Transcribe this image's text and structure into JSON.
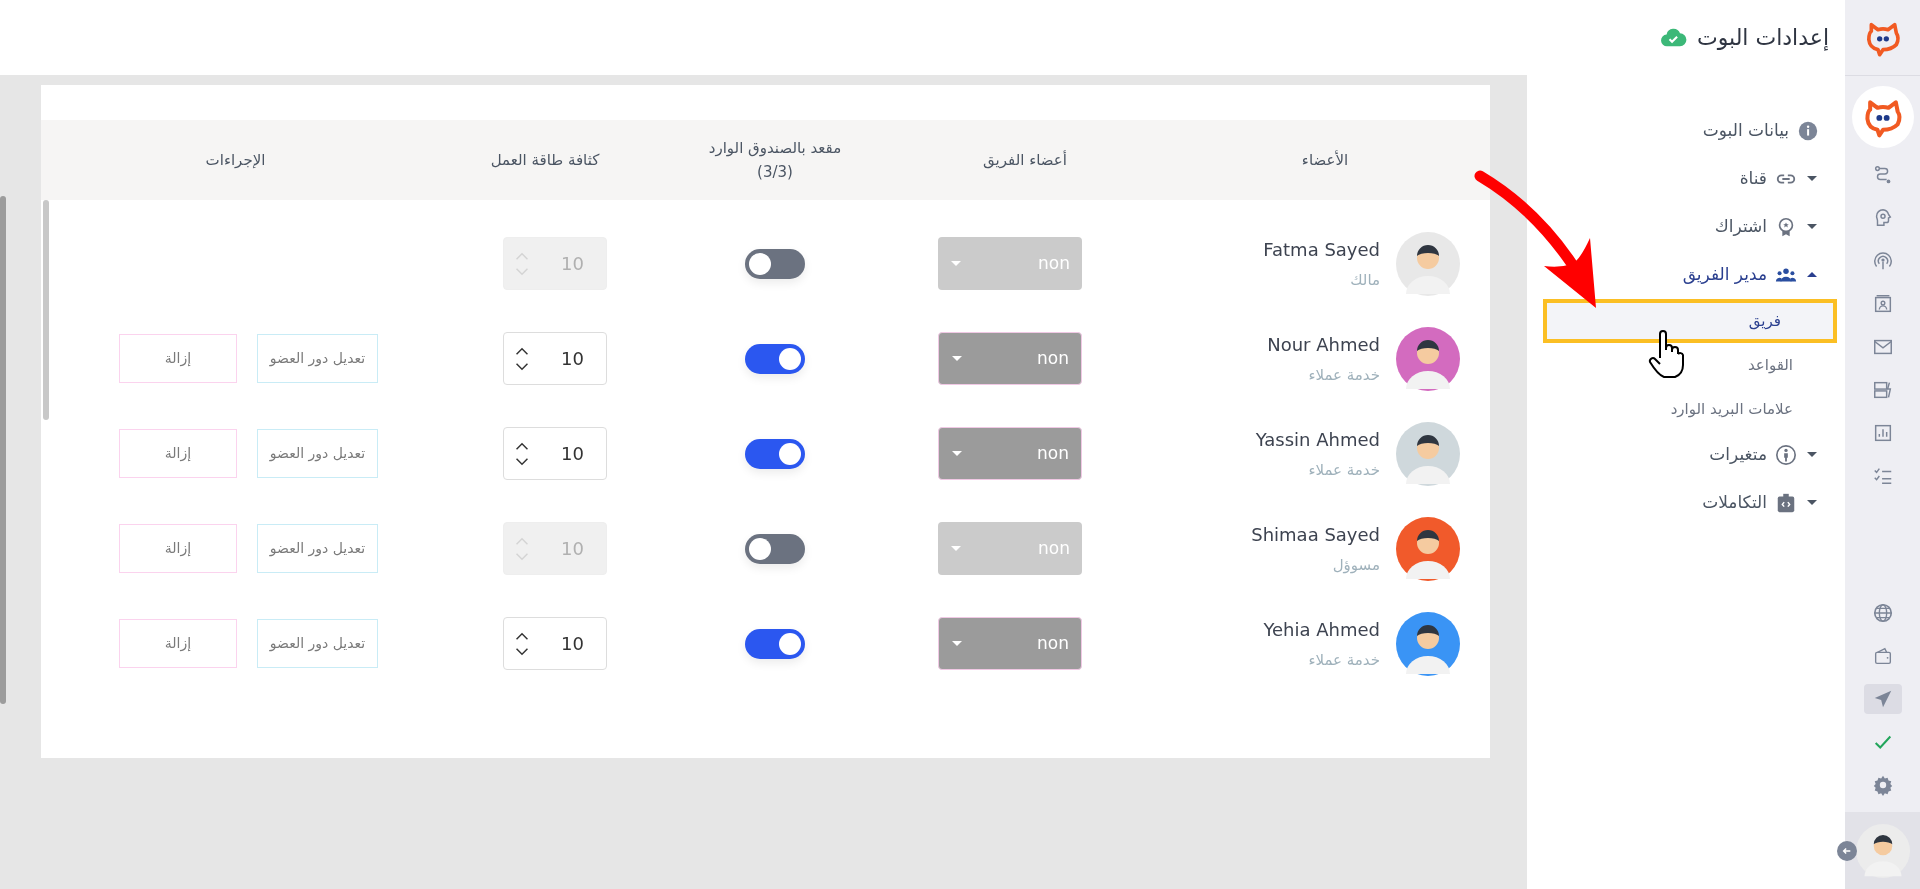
{
  "header": {
    "title": "إعدادات البوت",
    "saved": true
  },
  "nav": {
    "items": [
      {
        "label": "بيانات البوت"
      },
      {
        "label": "قناة",
        "expanded": false
      },
      {
        "label": "اشتراك",
        "expanded": false
      },
      {
        "label": "مدير الفريق",
        "expanded": true,
        "children": [
          {
            "label": "فريق",
            "selected": true
          },
          {
            "label": "القواعد",
            "selected": false
          },
          {
            "label": "علامات البريد الوارد",
            "selected": false
          }
        ]
      },
      {
        "label": "متغيرات",
        "expanded": false
      },
      {
        "label": "التكاملات",
        "expanded": false
      }
    ]
  },
  "rail": {
    "items": [
      {
        "selected": false
      },
      {
        "selected": false
      },
      {
        "selected": false
      },
      {
        "selected": false
      },
      {
        "selected": false
      },
      {
        "selected": false
      },
      {
        "selected": false
      },
      {
        "selected": false
      },
      {
        "selected": false
      },
      {
        "selected": false
      },
      {
        "selected": true
      },
      {
        "selected": false
      }
    ]
  },
  "table": {
    "columns": [
      {
        "label": "الأعضاء"
      },
      {
        "label": "أعضاء الفريق"
      },
      {
        "label": "مقعد بالصندوق الوارد",
        "note": "(3/3)"
      },
      {
        "label": "كثافة طاقة العمل"
      },
      {
        "label": "الإجراءات"
      }
    ],
    "rows": [
      {
        "name": "Fatma Sayed",
        "role": "مالك",
        "color": "#e8e8e8",
        "team": {
          "value": "non",
          "disabled": true
        },
        "inbox_seat": false,
        "workload": {
          "value": "10",
          "disabled": true
        }
      },
      {
        "name": "Nour Ahmed",
        "role": "خدمة عملاء",
        "color": "#d36bbf",
        "team": {
          "value": "non",
          "disabled": false
        },
        "inbox_seat": true,
        "workload": {
          "value": "10",
          "disabled": false
        },
        "actions": [
          {
            "label": "تعديل دور العضو",
            "kind": "edit"
          },
          {
            "label": "إزالة",
            "kind": "remove"
          }
        ]
      },
      {
        "name": "Yassin Ahmed",
        "role": "خدمة عملاء",
        "color": "#cfd8dc",
        "team": {
          "value": "non",
          "disabled": false
        },
        "inbox_seat": true,
        "workload": {
          "value": "10",
          "disabled": false
        },
        "actions": [
          {
            "label": "تعديل دور العضو",
            "kind": "edit"
          },
          {
            "label": "إزالة",
            "kind": "remove"
          }
        ]
      },
      {
        "name": "Shimaa Sayed",
        "role": "مسوؤل",
        "color": "#f15a2b",
        "team": {
          "value": "non",
          "disabled": true
        },
        "inbox_seat": false,
        "workload": {
          "value": "10",
          "disabled": true
        },
        "actions": [
          {
            "label": "تعديل دور العضو",
            "kind": "edit"
          },
          {
            "label": "إزالة",
            "kind": "remove"
          }
        ]
      },
      {
        "name": "Yehia Ahmed",
        "role": "خدمة عملاء",
        "color": "#3a94f5",
        "team": {
          "value": "non",
          "disabled": false
        },
        "inbox_seat": true,
        "workload": {
          "value": "10",
          "disabled": false
        },
        "actions": [
          {
            "label": "تعديل دور العضو",
            "kind": "edit"
          },
          {
            "label": "إزالة",
            "kind": "remove"
          }
        ]
      }
    ]
  }
}
